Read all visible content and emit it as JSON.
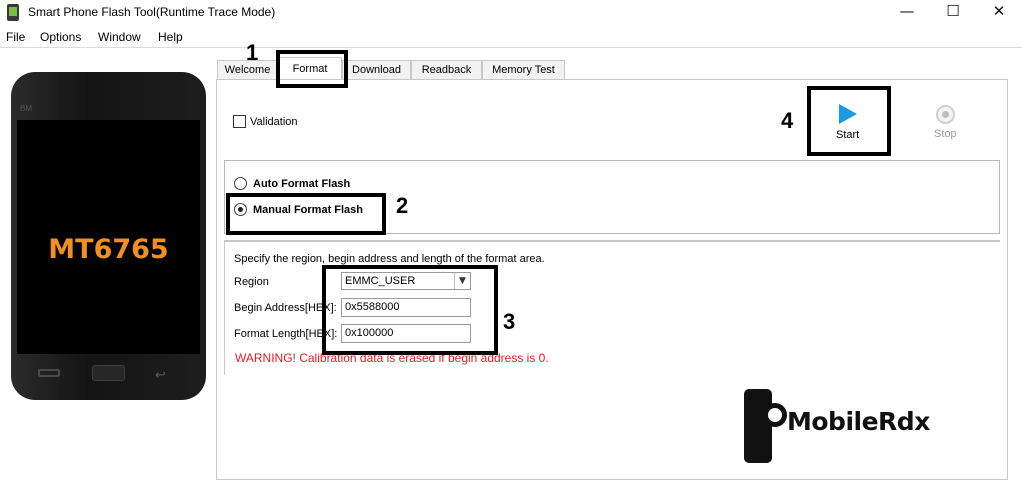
{
  "window": {
    "title": "Smart Phone Flash Tool(Runtime Trace Mode)",
    "controls": {
      "minimize": "—",
      "maximize": "☐",
      "close": "✕"
    }
  },
  "menu": [
    "File",
    "Options",
    "Window",
    "Help"
  ],
  "device": {
    "brand_mark": "BM",
    "chipset": "MT6765"
  },
  "tabs": [
    {
      "label": "Welcome",
      "active": false
    },
    {
      "label": "Format",
      "active": true
    },
    {
      "label": "Download",
      "active": false
    },
    {
      "label": "Readback",
      "active": false
    },
    {
      "label": "Memory Test",
      "active": false
    }
  ],
  "format": {
    "validation": {
      "label": "Validation",
      "checked": false
    },
    "start_label": "Start",
    "stop_label": "Stop",
    "modes": [
      {
        "label": "Auto Format Flash",
        "selected": false
      },
      {
        "label": "Manual Format Flash",
        "selected": true
      }
    ],
    "area": {
      "instruction": "Specify the region, begin address and length of the format area.",
      "region_label": "Region",
      "region_value": "EMMC_USER",
      "begin_label": "Begin Address[HEX]:",
      "begin_value": "0x5588000",
      "length_label": "Format Length[HEX]:",
      "length_value": "0x100000",
      "warning": "WARNING! Calibration data is erased if begin address is 0."
    }
  },
  "annotations": {
    "step1": "1",
    "step2": "2",
    "step3": "3",
    "step4": "4"
  },
  "watermark": {
    "text": "MobileRdx"
  },
  "colors": {
    "chipset_text": "#ef9020",
    "start_icon": "#1a9be0",
    "warning_text": "#e02020"
  }
}
